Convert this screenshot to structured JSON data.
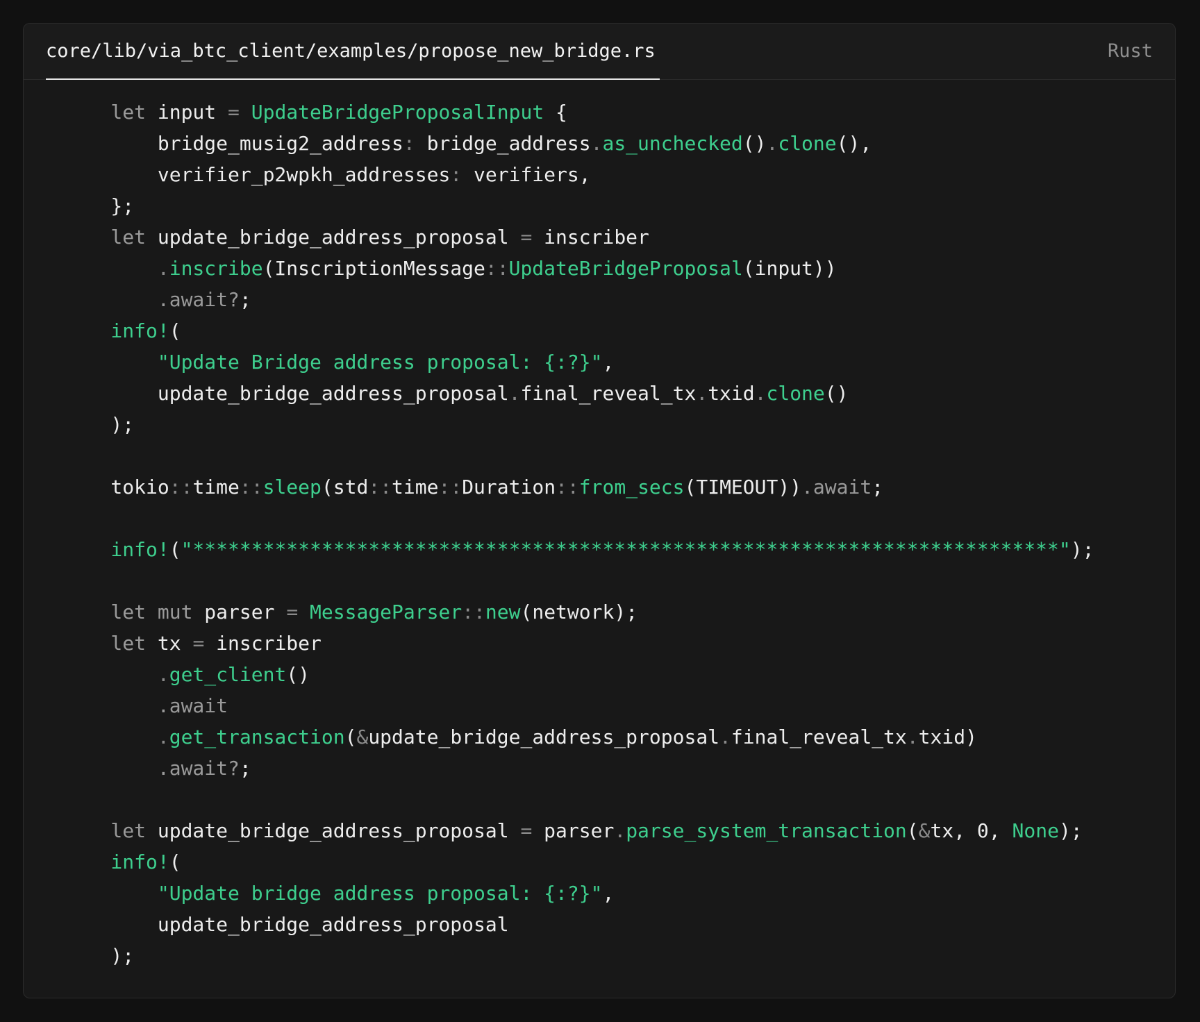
{
  "header": {
    "file_path": "core/lib/via_btc_client/examples/propose_new_bridge.rs",
    "language": "Rust"
  },
  "colors": {
    "background": "#111111",
    "panel": "#181818",
    "header": "#1b1b1b",
    "plain": "#ededed",
    "keyword": "#9a9a9a",
    "accent_green": "#3ecf8e",
    "punctuation": "#8a8a8a"
  },
  "code": {
    "lines": [
      [
        [
          "kw",
          "    let "
        ],
        [
          "plain",
          "input "
        ],
        [
          "punc",
          "= "
        ],
        [
          "fn",
          "UpdateBridgeProposalInput"
        ],
        [
          "plain",
          " {"
        ]
      ],
      [
        [
          "plain",
          "        bridge_musig2_address"
        ],
        [
          "punc",
          ": "
        ],
        [
          "plain",
          "bridge_address"
        ],
        [
          "punc",
          "."
        ],
        [
          "fn",
          "as_unchecked"
        ],
        [
          "plain",
          "()"
        ],
        [
          "punc",
          "."
        ],
        [
          "fn",
          "clone"
        ],
        [
          "plain",
          "(),"
        ]
      ],
      [
        [
          "plain",
          "        verifier_p2wpkh_addresses"
        ],
        [
          "punc",
          ": "
        ],
        [
          "plain",
          "verifiers,"
        ]
      ],
      [
        [
          "plain",
          "    };"
        ]
      ],
      [
        [
          "kw",
          "    let "
        ],
        [
          "plain",
          "update_bridge_address_proposal "
        ],
        [
          "punc",
          "= "
        ],
        [
          "plain",
          "inscriber"
        ]
      ],
      [
        [
          "punc",
          "        ."
        ],
        [
          "fn",
          "inscribe"
        ],
        [
          "plain",
          "(InscriptionMessage"
        ],
        [
          "punc",
          "::"
        ],
        [
          "fn",
          "UpdateBridgeProposal"
        ],
        [
          "plain",
          "(input))"
        ]
      ],
      [
        [
          "kw",
          "        .await?"
        ],
        [
          "plain",
          ";"
        ]
      ],
      [
        [
          "fn",
          "    info!"
        ],
        [
          "plain",
          "("
        ]
      ],
      [
        [
          "str",
          "        \"Update Bridge address proposal: {:?}\""
        ],
        [
          "plain",
          ","
        ]
      ],
      [
        [
          "plain",
          "        update_bridge_address_proposal"
        ],
        [
          "punc",
          "."
        ],
        [
          "plain",
          "final_reveal_tx"
        ],
        [
          "punc",
          "."
        ],
        [
          "plain",
          "txid"
        ],
        [
          "punc",
          "."
        ],
        [
          "fn",
          "clone"
        ],
        [
          "plain",
          "()"
        ]
      ],
      [
        [
          "plain",
          "    );"
        ]
      ],
      [
        [
          "plain",
          ""
        ]
      ],
      [
        [
          "plain",
          "    tokio"
        ],
        [
          "punc",
          "::"
        ],
        [
          "plain",
          "time"
        ],
        [
          "punc",
          "::"
        ],
        [
          "fn",
          "sleep"
        ],
        [
          "plain",
          "(std"
        ],
        [
          "punc",
          "::"
        ],
        [
          "plain",
          "time"
        ],
        [
          "punc",
          "::"
        ],
        [
          "plain",
          "Duration"
        ],
        [
          "punc",
          "::"
        ],
        [
          "fn",
          "from_secs"
        ],
        [
          "plain",
          "(TIMEOUT))"
        ],
        [
          "kw",
          ".await"
        ],
        [
          "plain",
          ";"
        ]
      ],
      [
        [
          "plain",
          ""
        ]
      ],
      [
        [
          "fn",
          "    info!"
        ],
        [
          "plain",
          "("
        ],
        [
          "str",
          "\"**************************************************************************\""
        ],
        [
          "plain",
          ");"
        ]
      ],
      [
        [
          "plain",
          ""
        ]
      ],
      [
        [
          "kw",
          "    let mut "
        ],
        [
          "plain",
          "parser "
        ],
        [
          "punc",
          "= "
        ],
        [
          "fn",
          "MessageParser"
        ],
        [
          "punc",
          "::"
        ],
        [
          "fn",
          "new"
        ],
        [
          "plain",
          "(network);"
        ]
      ],
      [
        [
          "kw",
          "    let "
        ],
        [
          "plain",
          "tx "
        ],
        [
          "punc",
          "= "
        ],
        [
          "plain",
          "inscriber"
        ]
      ],
      [
        [
          "punc",
          "        ."
        ],
        [
          "fn",
          "get_client"
        ],
        [
          "plain",
          "()"
        ]
      ],
      [
        [
          "kw",
          "        .await"
        ]
      ],
      [
        [
          "punc",
          "        ."
        ],
        [
          "fn",
          "get_transaction"
        ],
        [
          "plain",
          "("
        ],
        [
          "punc",
          "&"
        ],
        [
          "plain",
          "update_bridge_address_proposal"
        ],
        [
          "punc",
          "."
        ],
        [
          "plain",
          "final_reveal_tx"
        ],
        [
          "punc",
          "."
        ],
        [
          "plain",
          "txid)"
        ]
      ],
      [
        [
          "kw",
          "        .await?"
        ],
        [
          "plain",
          ";"
        ]
      ],
      [
        [
          "plain",
          ""
        ]
      ],
      [
        [
          "kw",
          "    let "
        ],
        [
          "plain",
          "update_bridge_address_proposal "
        ],
        [
          "punc",
          "= "
        ],
        [
          "plain",
          "parser"
        ],
        [
          "punc",
          "."
        ],
        [
          "fn",
          "parse_system_transaction"
        ],
        [
          "plain",
          "("
        ],
        [
          "punc",
          "&"
        ],
        [
          "plain",
          "tx, 0, "
        ],
        [
          "fn",
          "None"
        ],
        [
          "plain",
          ");"
        ]
      ],
      [
        [
          "fn",
          "    info!"
        ],
        [
          "plain",
          "("
        ]
      ],
      [
        [
          "str",
          "        \"Update bridge address proposal: {:?}\""
        ],
        [
          "plain",
          ","
        ]
      ],
      [
        [
          "plain",
          "        update_bridge_address_proposal"
        ]
      ],
      [
        [
          "plain",
          "    );"
        ]
      ]
    ]
  }
}
